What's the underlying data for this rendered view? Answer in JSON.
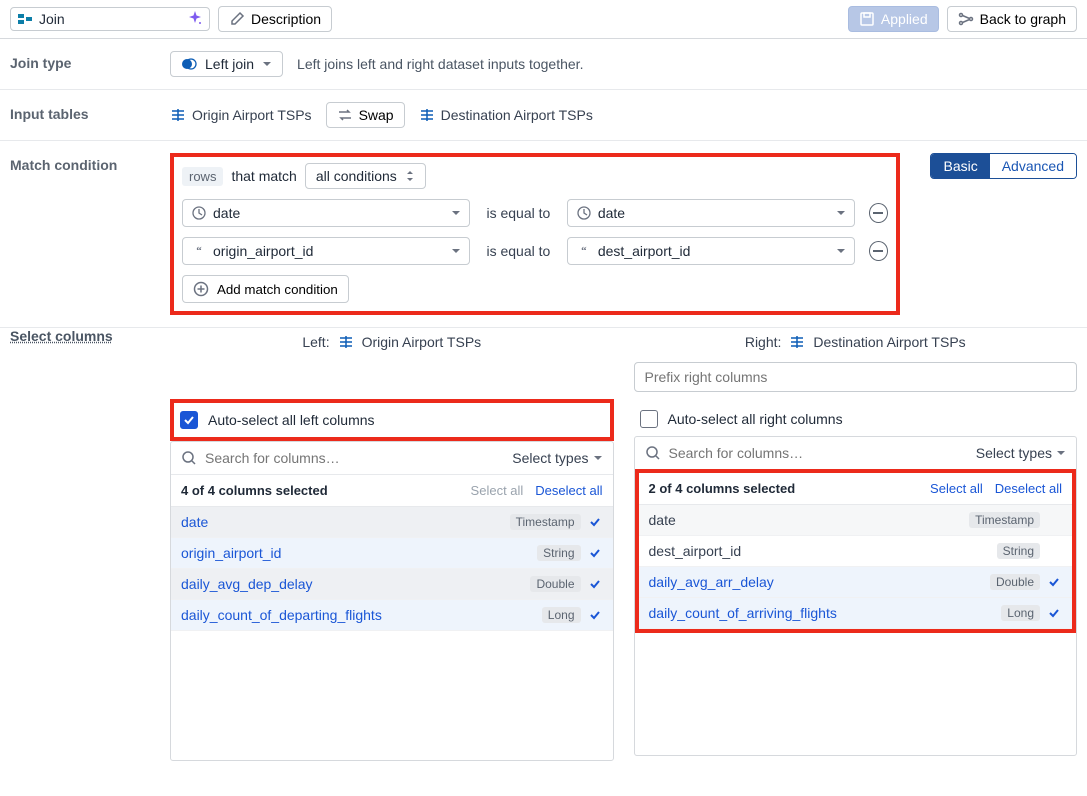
{
  "topbar": {
    "node_type": "Join",
    "description_btn": "Description",
    "applied_btn": "Applied",
    "back_btn": "Back to graph"
  },
  "join_type": {
    "label": "Join type",
    "value": "Left join",
    "hint": "Left joins left and right dataset inputs together."
  },
  "input_tables": {
    "label": "Input tables",
    "left": "Origin Airport TSPs",
    "swap": "Swap",
    "right": "Destination Airport TSPs"
  },
  "match": {
    "label": "Match condition",
    "rows_tag": "rows",
    "that_match": "that match",
    "mode": "all conditions",
    "conditions": [
      {
        "left_type": "ts",
        "left": "date",
        "op": "is equal to",
        "right_type": "ts",
        "right": "date"
      },
      {
        "left_type": "str",
        "left": "origin_airport_id",
        "op": "is equal to",
        "right_type": "str",
        "right": "dest_airport_id"
      }
    ],
    "add_btn": "Add match condition",
    "basic": "Basic",
    "advanced": "Advanced"
  },
  "select": {
    "label": "Select columns",
    "left_title": "Left:",
    "left_table": "Origin Airport TSPs",
    "right_title": "Right:",
    "right_table": "Destination Airport TSPs",
    "prefix_placeholder": "Prefix right columns",
    "auto_left": "Auto-select all left columns",
    "auto_right": "Auto-select all right columns",
    "search_placeholder": "Search for columns…",
    "select_types": "Select types",
    "select_all": "Select all",
    "deselect_all": "Deselect all",
    "left_count": "4 of 4 columns selected",
    "right_count": "2 of 4 columns selected",
    "left_cols": [
      {
        "name": "date",
        "type": "Timestamp",
        "selected": true
      },
      {
        "name": "origin_airport_id",
        "type": "String",
        "selected": true
      },
      {
        "name": "daily_avg_dep_delay",
        "type": "Double",
        "selected": true
      },
      {
        "name": "daily_count_of_departing_flights",
        "type": "Long",
        "selected": true
      }
    ],
    "right_cols": [
      {
        "name": "date",
        "type": "Timestamp",
        "selected": false
      },
      {
        "name": "dest_airport_id",
        "type": "String",
        "selected": false
      },
      {
        "name": "daily_avg_arr_delay",
        "type": "Double",
        "selected": true
      },
      {
        "name": "daily_count_of_arriving_flights",
        "type": "Long",
        "selected": true
      }
    ]
  }
}
